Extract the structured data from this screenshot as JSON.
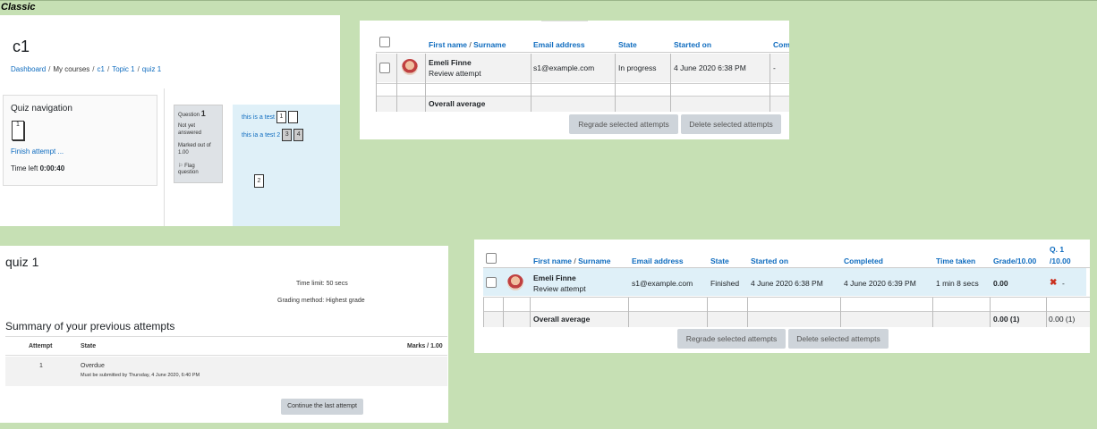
{
  "label": "Classic",
  "panelA": {
    "course_title": "c1",
    "breadcrumb": [
      "Dashboard",
      "My courses",
      "c1",
      "Topic 1",
      "quiz 1"
    ],
    "quiz_nav_title": "Quiz navigation",
    "nav_button": "1",
    "finish_attempt": "Finish attempt ...",
    "time_left_label": "Time left",
    "time_left_value": "0:00:40",
    "question_label": "Question",
    "question_number": "1",
    "status_line1": "Not yet",
    "status_line2": "answered",
    "marked_line1": "Marked out of",
    "marked_line2": "1.00",
    "flag_line1": "Flag",
    "flag_line2": "question",
    "row1_text": "this is a test",
    "row1_box1": "1",
    "row2_text": "this ia a test 2",
    "row2_box1": "3",
    "row2_box2": "4",
    "drag_item": "2"
  },
  "panelB": {
    "headers": {
      "first_name": "First name",
      "slash": " / ",
      "surname": "Surname",
      "email": "Email address",
      "state": "State",
      "started": "Started on",
      "completed_partial": "Com"
    },
    "row": {
      "name": "Emeli Finne",
      "review": "Review attempt",
      "email": "s1@example.com",
      "state": "In progress",
      "started": "4 June 2020 6:38 PM",
      "completed": "-"
    },
    "overall": "Overall average",
    "regrade_btn": "Regrade selected attempts",
    "delete_btn": "Delete selected attempts"
  },
  "panelC": {
    "quiz_title": "quiz 1",
    "time_limit": "Time limit: 50 secs",
    "grading_method": "Grading method: Highest grade",
    "summary_title": "Summary of your previous attempts",
    "col_attempt": "Attempt",
    "col_state": "State",
    "col_marks": "Marks / 1.00",
    "attempt_no": "1",
    "state": "Overdue",
    "state_note": "Must be submitted by Thursday, 4 June 2020, 6:40 PM",
    "continue_btn": "Continue the last attempt"
  },
  "panelD": {
    "headers": {
      "first_name": "First name",
      "slash": " / ",
      "surname": "Surname",
      "email": "Email address",
      "state": "State",
      "started": "Started on",
      "completed": "Completed",
      "time_taken": "Time taken",
      "grade": "Grade/10.00",
      "q1_line1": "Q. 1",
      "q1_line2": "/10.00"
    },
    "row": {
      "name": "Emeli Finne",
      "review": "Review attempt",
      "email": "s1@example.com",
      "state": "Finished",
      "started": "4 June 2020 6:38 PM",
      "completed": "4 June 2020 6:39 PM",
      "time_taken": "1 min 8 secs",
      "grade": "0.00",
      "q1": "-"
    },
    "overall": "Overall average",
    "overall_grade": "0.00 (1)",
    "overall_q1": "0.00 (1)",
    "regrade_btn": "Regrade selected attempts",
    "delete_btn": "Delete selected attempts"
  }
}
